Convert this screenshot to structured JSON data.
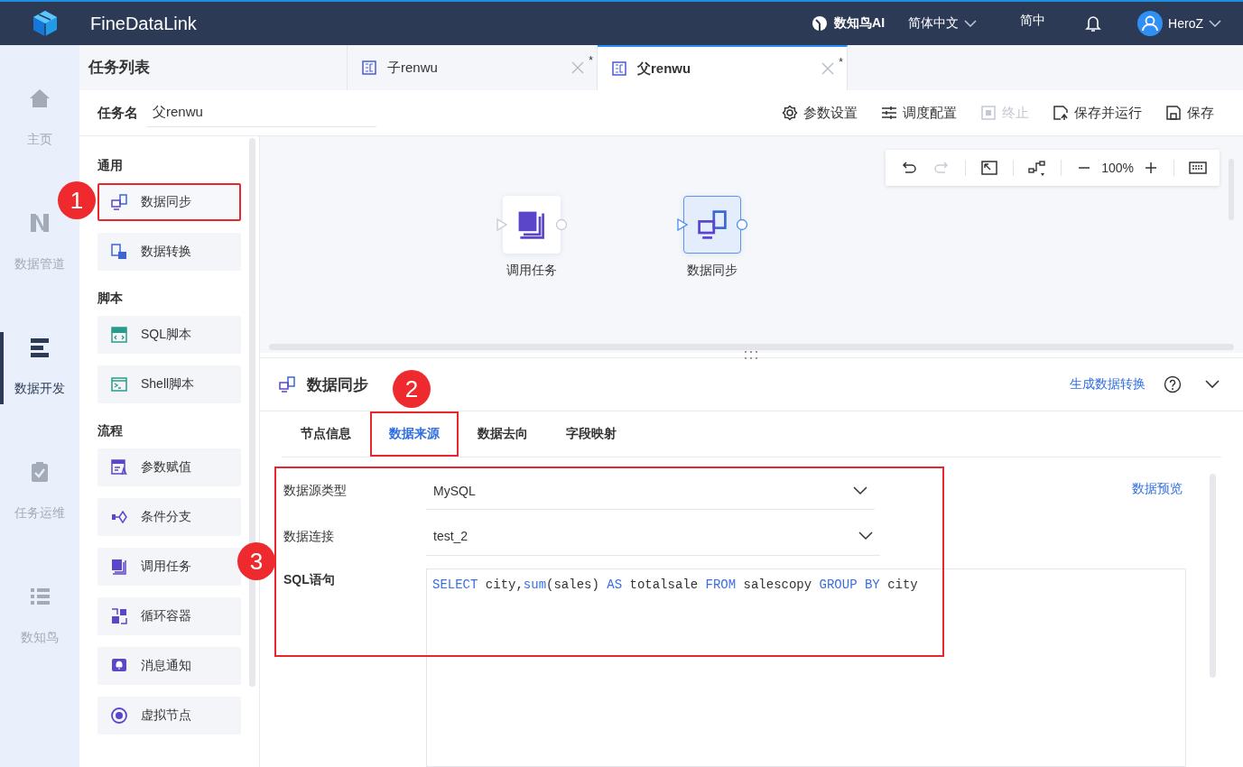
{
  "header": {
    "app_name": "FineDataLink",
    "ai_label": "数知鸟AI",
    "language": "简体中文",
    "short_language": "简中",
    "user": "HeroZ"
  },
  "nav": [
    {
      "label": "主页",
      "selected": false
    },
    {
      "label": "数据管道",
      "selected": false
    },
    {
      "label": "数据开发",
      "selected": true
    },
    {
      "label": "任务运维",
      "selected": false
    },
    {
      "label": "数知鸟",
      "selected": false
    }
  ],
  "task_list_title": "任务列表",
  "editor_tabs": [
    {
      "label": "子renwu",
      "modified": "*",
      "selected": false
    },
    {
      "label": "父renwu",
      "modified": "*",
      "selected": true
    }
  ],
  "task_name": {
    "label": "任务名",
    "value": "父renwu"
  },
  "actions": [
    {
      "label": "参数设置",
      "disabled": false
    },
    {
      "label": "调度配置",
      "disabled": false
    },
    {
      "label": "终止",
      "disabled": true
    },
    {
      "label": "保存并运行",
      "disabled": false
    },
    {
      "label": "保存",
      "disabled": false
    }
  ],
  "components": [
    {
      "group": "通用",
      "items": [
        {
          "label": "数据同步",
          "highlighted": true,
          "callout": "1"
        },
        {
          "label": "数据转换",
          "highlighted": false
        }
      ]
    },
    {
      "group": "脚本",
      "items": [
        {
          "label": "SQL脚本",
          "highlighted": false
        },
        {
          "label": "Shell脚本",
          "highlighted": false
        }
      ]
    },
    {
      "group": "流程",
      "items": [
        {
          "label": "参数赋值",
          "highlighted": false
        },
        {
          "label": "条件分支",
          "highlighted": false
        },
        {
          "label": "调用任务",
          "highlighted": false
        },
        {
          "label": "循环容器",
          "highlighted": false
        },
        {
          "label": "消息通知",
          "highlighted": false
        },
        {
          "label": "虚拟节点",
          "highlighted": false
        }
      ]
    }
  ],
  "canvas_toolbar": {
    "redo_disabled": true,
    "zoom": "100%"
  },
  "nodes": [
    {
      "label": "调用任务",
      "selected": false
    },
    {
      "label": "数据同步",
      "selected": true
    }
  ],
  "detail": {
    "title": "数据同步",
    "generate_link": "生成数据转换",
    "tabs": [
      {
        "label": "节点信息",
        "selected": false,
        "highlighted": false
      },
      {
        "label": "数据来源",
        "selected": true,
        "highlighted": true,
        "callout": "2"
      },
      {
        "label": "数据去向",
        "selected": false,
        "highlighted": false
      },
      {
        "label": "字段映射",
        "selected": false,
        "highlighted": false
      }
    ],
    "form": {
      "highlighted": true,
      "callout": "3",
      "preview_link": "数据预览",
      "source_type": {
        "label": "数据源类型",
        "value": "MySQL"
      },
      "connection": {
        "label": "数据连接",
        "value": "test_2"
      },
      "sql": {
        "label": "SQL语句",
        "tokens": [
          {
            "text": "SELECT",
            "kind": "keyword"
          },
          {
            "text": " city,",
            "kind": "plain"
          },
          {
            "text": "sum",
            "kind": "keyword"
          },
          {
            "text": "(sales) ",
            "kind": "plain"
          },
          {
            "text": "AS",
            "kind": "keyword"
          },
          {
            "text": " totalsale ",
            "kind": "plain"
          },
          {
            "text": "FROM",
            "kind": "keyword"
          },
          {
            "text": " salescopy ",
            "kind": "plain"
          },
          {
            "text": "GROUP BY",
            "kind": "keyword"
          },
          {
            "text": " city",
            "kind": "plain"
          }
        ]
      }
    }
  }
}
